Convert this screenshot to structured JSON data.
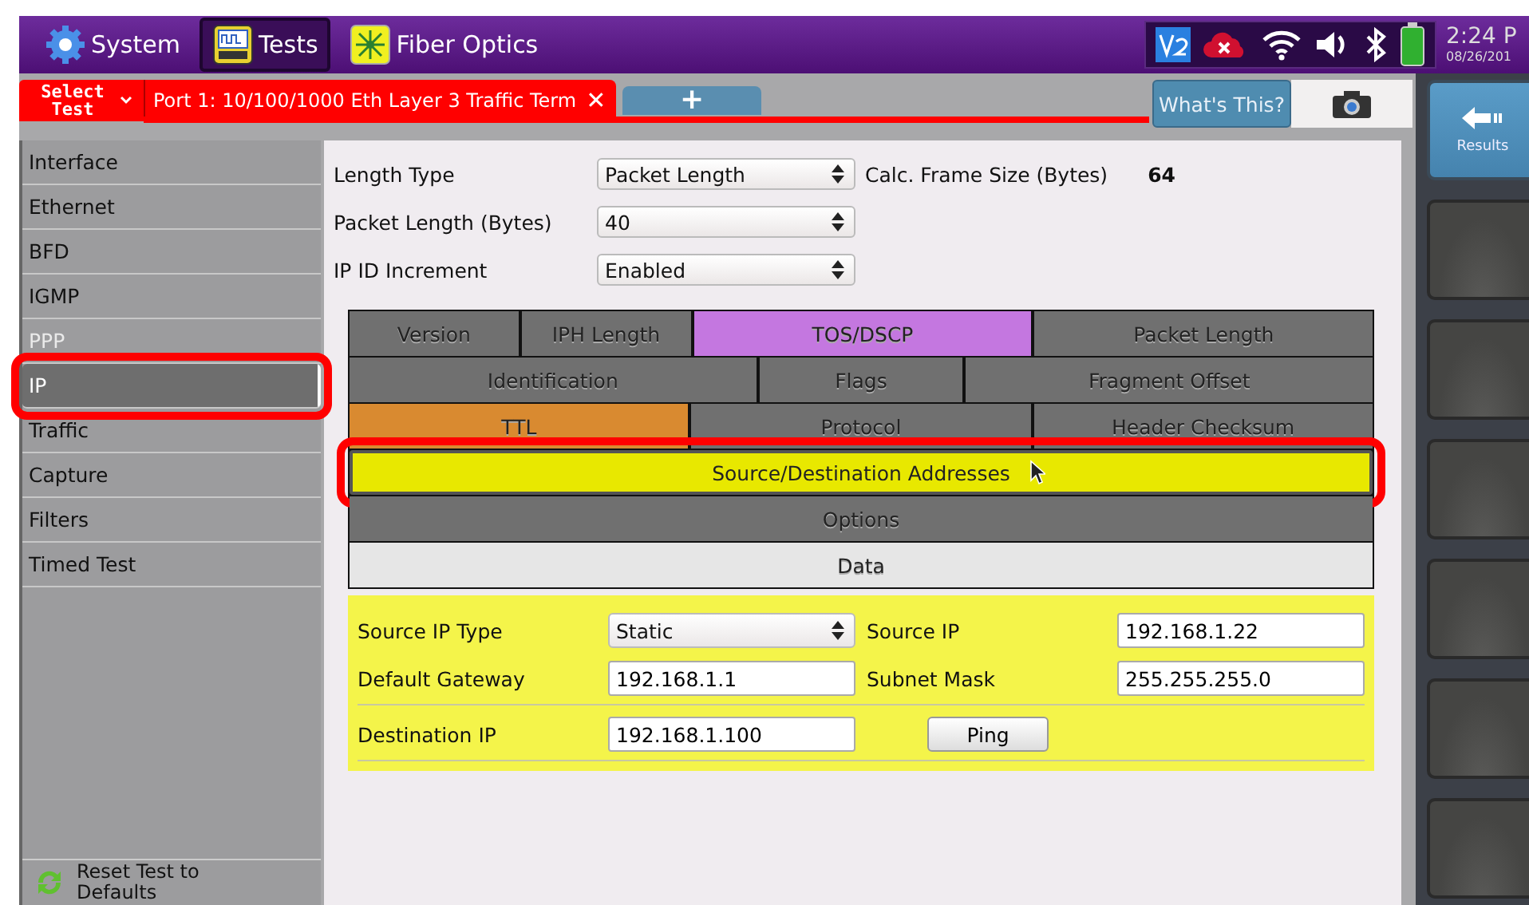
{
  "top_bar": {
    "apps": [
      {
        "label": "System",
        "kind": "gear",
        "selected": false
      },
      {
        "label": "Tests",
        "kind": "bert",
        "selected": true
      },
      {
        "label": "Fiber Optics",
        "kind": "fiber",
        "selected": false
      }
    ],
    "time": "2:24 P",
    "date": "08/26/201"
  },
  "test_tabs": {
    "select_test": "Select Test",
    "active_tab": "Port 1: 10/100/1000 Eth Layer 3 Traffic Term",
    "close": "✕",
    "add_tab": "+",
    "help": "What's This?"
  },
  "sidebar": {
    "items": [
      {
        "label": "Interface",
        "selected": false,
        "disabled": false,
        "highlighted": false
      },
      {
        "label": "Ethernet",
        "selected": false,
        "disabled": false,
        "highlighted": false
      },
      {
        "label": "BFD",
        "selected": false,
        "disabled": false,
        "highlighted": false
      },
      {
        "label": "IGMP",
        "selected": false,
        "disabled": false,
        "highlighted": false
      },
      {
        "label": "PPP",
        "selected": false,
        "disabled": true,
        "highlighted": false
      },
      {
        "label": "IP",
        "selected": true,
        "disabled": false,
        "highlighted": true
      },
      {
        "label": "Traffic",
        "selected": false,
        "disabled": false,
        "highlighted": false
      },
      {
        "label": "Capture",
        "selected": false,
        "disabled": false,
        "highlighted": false
      },
      {
        "label": "Filters",
        "selected": false,
        "disabled": false,
        "highlighted": false
      },
      {
        "label": "Timed Test",
        "selected": false,
        "disabled": false,
        "highlighted": false
      }
    ],
    "reset": "Reset Test to Defaults"
  },
  "settings": [
    {
      "label": "Length Type",
      "value": "Packet Length",
      "extra_label": "Calc. Frame Size (Bytes)",
      "extra_value": "64"
    },
    {
      "label": "Packet Length (Bytes)",
      "value": "40"
    },
    {
      "label": "IP ID Increment",
      "value": "Enabled"
    }
  ],
  "header_fields": {
    "lines": [
      {
        "fields": [
          {
            "label": "Version",
            "color": "#707070",
            "selected": false,
            "highlighted": false
          },
          {
            "label": "IPH Length",
            "color": "#707070",
            "selected": false,
            "highlighted": false
          },
          {
            "label": "TOS/DSCP",
            "color": "#c477e0",
            "selected": false,
            "highlighted": false
          },
          {
            "label": "Packet Length",
            "color": "#707070",
            "selected": false,
            "highlighted": false
          }
        ]
      },
      {
        "fields": [
          {
            "label": "Identification",
            "color": "#707070",
            "selected": false,
            "highlighted": false
          },
          {
            "label": "Flags",
            "color": "#707070",
            "selected": false,
            "highlighted": false
          },
          {
            "label": "Fragment Offset",
            "color": "#707070",
            "selected": false,
            "highlighted": false
          }
        ]
      },
      {
        "fields": [
          {
            "label": "TTL",
            "color": "#d98a30",
            "selected": false,
            "highlighted": false
          },
          {
            "label": "Protocol",
            "color": "#707070",
            "selected": false,
            "highlighted": false
          },
          {
            "label": "Header Checksum",
            "color": "#707070",
            "selected": false,
            "highlighted": false
          }
        ]
      },
      {
        "fields": [
          {
            "label": "Source/Destination Addresses",
            "color": "#e8e800",
            "selected": true,
            "highlighted": true
          }
        ]
      },
      {
        "fields": [
          {
            "label": "Options",
            "color": "#707070",
            "selected": false,
            "highlighted": false
          }
        ]
      },
      {
        "fields": [
          {
            "label": "Data",
            "color": "#e6e6e6",
            "selected": false,
            "highlighted": false
          }
        ]
      }
    ]
  },
  "address_panel": {
    "sections": [
      [
        [
          {
            "kind": "label",
            "text": "Source IP Type"
          },
          {
            "kind": "dropdown",
            "text": "Static"
          },
          {
            "kind": "label",
            "text": "Source IP"
          },
          {
            "kind": "input",
            "text": "192.168.1.22"
          }
        ],
        [
          {
            "kind": "label",
            "text": "Default Gateway"
          },
          {
            "kind": "input",
            "text": "192.168.1.1"
          },
          {
            "kind": "label",
            "text": "Subnet Mask"
          },
          {
            "kind": "input",
            "text": "255.255.255.0"
          }
        ]
      ],
      [
        [
          {
            "kind": "label",
            "text": "Destination IP"
          },
          {
            "kind": "input",
            "text": "192.168.1.100"
          },
          {
            "kind": "button",
            "text": "Ping"
          }
        ]
      ]
    ]
  },
  "right_panel": {
    "buttons": [
      {
        "kind": "back",
        "label": "Results"
      },
      {
        "kind": "blank"
      },
      {
        "kind": "blank"
      },
      {
        "kind": "blank"
      },
      {
        "kind": "blank"
      },
      {
        "kind": "blank"
      },
      {
        "kind": "blank"
      }
    ]
  }
}
